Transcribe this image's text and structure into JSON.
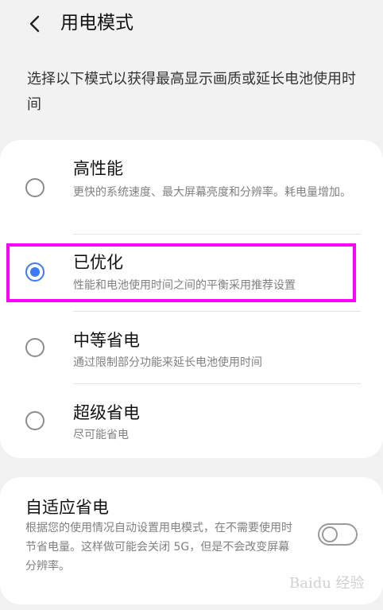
{
  "header": {
    "title": "用电模式",
    "back_icon": "chevron-left-icon"
  },
  "intro": "选择以下模式以获得最高显示画质或延长电池使用时间",
  "modes": [
    {
      "title": "高性能",
      "description": "更快的系统速度、最大屏幕亮度和分辨率。耗电量增加。",
      "selected": false
    },
    {
      "title": "已优化",
      "description": "性能和电池使用时间之间的平衡采用推荐设置",
      "selected": true
    },
    {
      "title": "中等省电",
      "description": "通过限制部分功能来延长电池使用时间",
      "selected": false
    },
    {
      "title": "超级省电",
      "description": "尽可能省电",
      "selected": false
    }
  ],
  "adaptive": {
    "title": "自适应省电",
    "description": "根据您的使用情况自动设置用电模式，在不需要使用时节省电量。这样做可能会关闭 5G，但是不会改变屏幕分辨率。",
    "enabled": false
  },
  "colors": {
    "accent": "#3d7af5",
    "highlight": "#ff00ff",
    "background": "#f2f2f2"
  },
  "watermark": "Baidu 经验"
}
